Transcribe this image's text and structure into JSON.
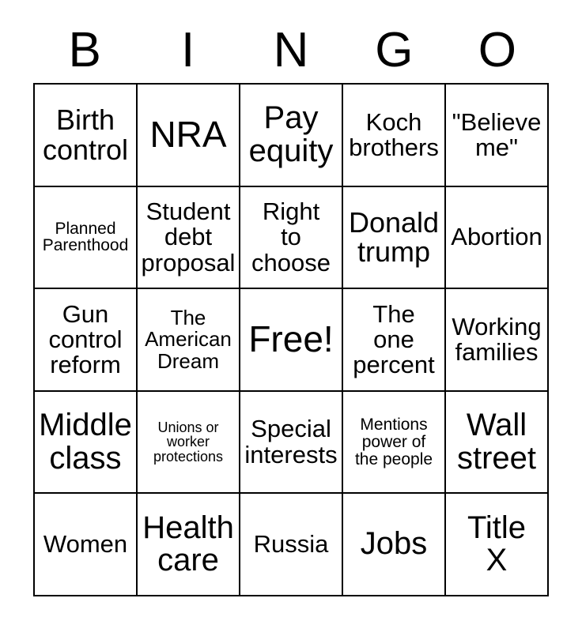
{
  "card": {
    "header_letters": [
      "B",
      "I",
      "N",
      "G",
      "O"
    ],
    "rows": [
      [
        {
          "text": "Birth\ncontrol",
          "size": "lg"
        },
        {
          "text": "NRA",
          "size": "xxl"
        },
        {
          "text": "Pay\nequity",
          "size": "xl"
        },
        {
          "text": "Koch\nbrothers",
          "size": "md"
        },
        {
          "text": "\"Believe\nme\"",
          "size": "md"
        }
      ],
      [
        {
          "text": "Planned\nParenthood",
          "size": "xs"
        },
        {
          "text": "Student\ndebt\nproposal",
          "size": "md"
        },
        {
          "text": "Right\nto\nchoose",
          "size": "md"
        },
        {
          "text": "Donald\ntrump",
          "size": "lg"
        },
        {
          "text": "Abortion",
          "size": "md"
        }
      ],
      [
        {
          "text": "Gun\ncontrol\nreform",
          "size": "md"
        },
        {
          "text": "The\nAmerican\nDream",
          "size": "sm"
        },
        {
          "text": "Free!",
          "size": "xxl"
        },
        {
          "text": "The\none\npercent",
          "size": "md"
        },
        {
          "text": "Working\nfamilies",
          "size": "md"
        }
      ],
      [
        {
          "text": "Middle\nclass",
          "size": "xl"
        },
        {
          "text": "Unions or\nworker\nprotections",
          "size": "xxs"
        },
        {
          "text": "Special\ninterests",
          "size": "md"
        },
        {
          "text": "Mentions\npower of\nthe people",
          "size": "xs"
        },
        {
          "text": "Wall\nstreet",
          "size": "xl"
        }
      ],
      [
        {
          "text": "Women",
          "size": "md"
        },
        {
          "text": "Health\ncare",
          "size": "xl"
        },
        {
          "text": "Russia",
          "size": "md"
        },
        {
          "text": "Jobs",
          "size": "xl"
        },
        {
          "text": "Title\nX",
          "size": "xl"
        }
      ]
    ],
    "free_space": {
      "row": 2,
      "col": 2,
      "label": "Free!"
    },
    "colors": {
      "background": "#ffffff",
      "text": "#000000",
      "border": "#000000"
    }
  }
}
